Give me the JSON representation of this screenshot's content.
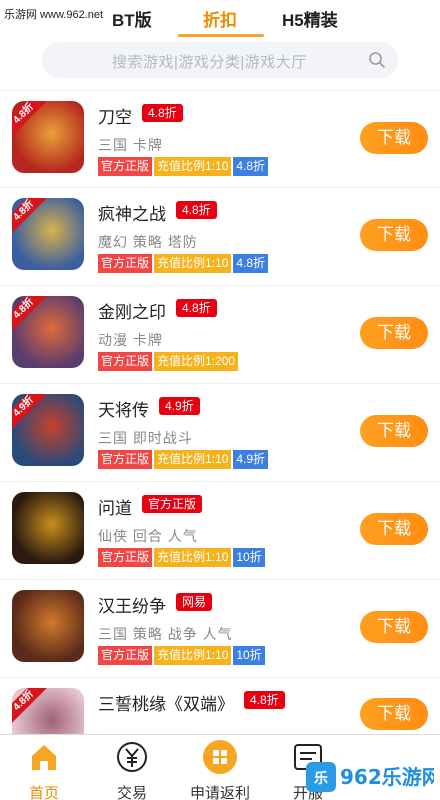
{
  "watermark_top": "乐游网 www.962.net",
  "tabs": [
    {
      "label": "BT版"
    },
    {
      "label": "折扣"
    },
    {
      "label": "H5精装"
    }
  ],
  "search": {
    "placeholder": "搜索游戏|游戏分类|游戏大厅"
  },
  "download_label": "下载",
  "games": [
    {
      "name": "刀空",
      "tag": "4.8折",
      "corner": "4.8折",
      "desc": "三国 卡牌",
      "badges": [
        {
          "text": "官方正版",
          "color": "red"
        },
        {
          "text": "充值比例1:10",
          "color": "yellow"
        },
        {
          "text": "4.8折",
          "color": "blue"
        }
      ]
    },
    {
      "name": "疯神之战",
      "tag": "4.8折",
      "corner": "4.8折",
      "desc": "魔幻 策略 塔防",
      "badges": [
        {
          "text": "官方正版",
          "color": "red"
        },
        {
          "text": "充值比例1:10",
          "color": "yellow"
        },
        {
          "text": "4.8折",
          "color": "blue"
        }
      ]
    },
    {
      "name": "金刚之印",
      "tag": "4.8折",
      "corner": "4.8折",
      "desc": "动漫 卡牌",
      "badges": [
        {
          "text": "官方正版",
          "color": "red"
        },
        {
          "text": "充值比例1:200",
          "color": "yellow"
        }
      ]
    },
    {
      "name": "天将传",
      "tag": "4.9折",
      "corner": "4.9折",
      "desc": "三国 即时战斗",
      "badges": [
        {
          "text": "官方正版",
          "color": "red"
        },
        {
          "text": "充值比例1:10",
          "color": "yellow"
        },
        {
          "text": "4.9折",
          "color": "blue"
        }
      ]
    },
    {
      "name": "问道",
      "tag": "官方正版",
      "corner": "",
      "desc": "仙侠 回合 人气",
      "badges": [
        {
          "text": "官方正版",
          "color": "red"
        },
        {
          "text": "充值比例1:10",
          "color": "yellow"
        },
        {
          "text": "10折",
          "color": "blue"
        }
      ]
    },
    {
      "name": "汉王纷争",
      "tag": "网易",
      "corner": "",
      "desc": "三国 策略 战争 人气",
      "badges": [
        {
          "text": "官方正版",
          "color": "red"
        },
        {
          "text": "充值比例1:10",
          "color": "yellow"
        },
        {
          "text": "10折",
          "color": "blue"
        }
      ]
    },
    {
      "name": "三誓桃缘《双端》",
      "tag": "4.8折",
      "corner": "4.8折",
      "desc": "",
      "badges": []
    }
  ],
  "bottom_nav": [
    {
      "label": "首页",
      "icon": "home-icon"
    },
    {
      "label": "交易",
      "icon": "yen-icon"
    },
    {
      "label": "申请返利",
      "icon": "grid-icon"
    },
    {
      "label": "开服",
      "icon": "server-icon"
    }
  ],
  "watermark_bottom": "962乐游网",
  "colors": {
    "accent": "#f08a00",
    "tag_red": "#e60012",
    "badge_red": "#f04646",
    "badge_yellow": "#f6b21c",
    "badge_blue": "#3d7fe0"
  }
}
